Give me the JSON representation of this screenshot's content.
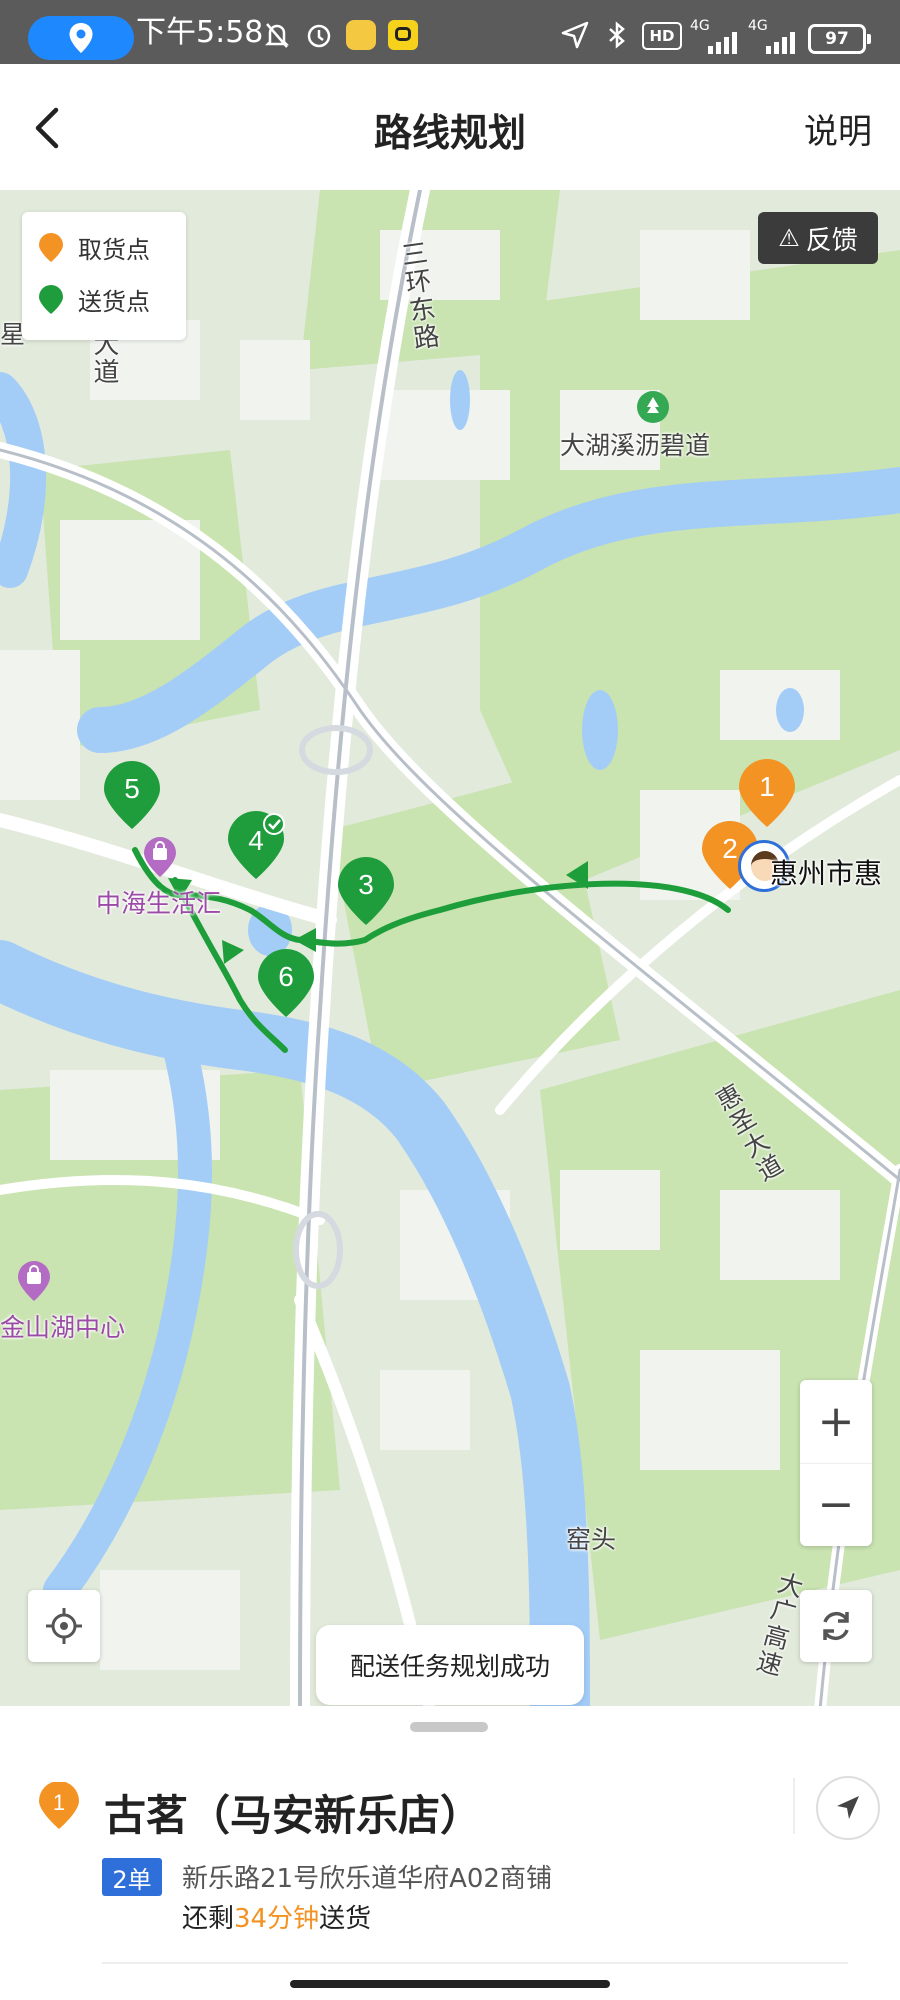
{
  "status_bar": {
    "time": "下午5:58",
    "network_1": "4G",
    "network_2": "4G",
    "hd_badge": "HD",
    "battery": "97",
    "icons": [
      "location-icon",
      "mute-bell-icon",
      "alarm-icon",
      "app-icon",
      "app-icon",
      "navigation-arrow-icon",
      "bluetooth-icon",
      "hd-icon",
      "signal-icon",
      "battery-icon"
    ]
  },
  "header": {
    "title": "路线规划",
    "help_label": "说明",
    "back_icon": "chevron-left-icon"
  },
  "map": {
    "legend": {
      "pickup_label": "取货点",
      "delivery_label": "送货点",
      "pickup_color": "#f39323",
      "delivery_color": "#1f9d3d"
    },
    "feedback_label": "反馈",
    "labels": {
      "ring_road": "三环东路",
      "park": "大湖溪沥碧道",
      "mall_1": "中海生活汇",
      "mall_2": "金山湖中心",
      "avenue": "惠圣大道",
      "village": "窑头",
      "expressway": "大广高速",
      "rider_city": "惠州市惠",
      "left_road": "大道",
      "left_edge": "星"
    },
    "pins": [
      {
        "number": "1",
        "type": "pickup"
      },
      {
        "number": "2",
        "type": "pickup"
      },
      {
        "number": "3",
        "type": "delivery"
      },
      {
        "number": "4",
        "type": "delivery",
        "completed": true
      },
      {
        "number": "5",
        "type": "delivery"
      },
      {
        "number": "6",
        "type": "delivery"
      }
    ],
    "route_color": "#1e9e3a",
    "zoom_in_label": "+",
    "zoom_out_label": "−",
    "toast": "配送任务规划成功"
  },
  "sheet": {
    "stop_number": "1",
    "store_name": "古茗（马安新乐店）",
    "order_badge": "2单",
    "address": "新乐路21号欣乐道华府A02商铺",
    "eta_prefix": "还剩",
    "eta_value": "34分钟",
    "eta_suffix": "送货"
  }
}
